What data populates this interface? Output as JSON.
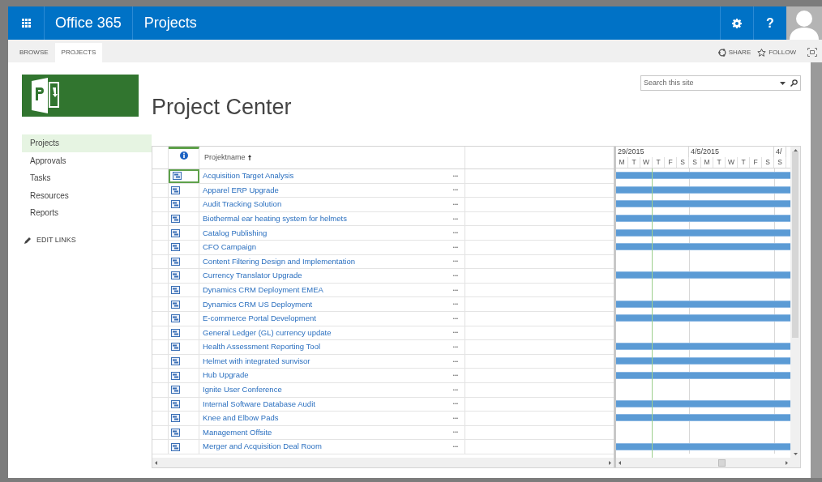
{
  "suite_bar": {
    "brand": "Office 365",
    "app": "Projects",
    "help": "?"
  },
  "ribbon": {
    "tabs": [
      {
        "label": "BROWSE",
        "selected": false
      },
      {
        "label": "PROJECTS",
        "selected": true
      }
    ],
    "actions": [
      {
        "label": "SHARE",
        "kind": "share"
      },
      {
        "label": "FOLLOW",
        "kind": "follow"
      }
    ]
  },
  "search": {
    "placeholder": "Search this site"
  },
  "page_title": "Project Center",
  "nav": {
    "items": [
      {
        "label": "Projects",
        "selected": true
      },
      {
        "label": "Approvals",
        "selected": false
      },
      {
        "label": "Tasks",
        "selected": false
      },
      {
        "label": "Resources",
        "selected": false
      },
      {
        "label": "Reports",
        "selected": false
      }
    ],
    "edit_links": "EDIT LINKS"
  },
  "grid": {
    "column": "Projektname",
    "rows": [
      {
        "name": "Acquisition Target Analysis",
        "focused": true,
        "bar": true
      },
      {
        "name": "Apparel ERP Upgrade",
        "focused": false,
        "bar": true
      },
      {
        "name": "Audit Tracking Solution",
        "focused": false,
        "bar": true
      },
      {
        "name": "Biothermal ear heating system for helmets",
        "focused": false,
        "bar": true
      },
      {
        "name": "Catalog Publishing",
        "focused": false,
        "bar": true
      },
      {
        "name": "CFO Campaign",
        "focused": false,
        "bar": true
      },
      {
        "name": "Content Filtering Design and Implementation",
        "focused": false,
        "bar": false
      },
      {
        "name": "Currency Translator Upgrade",
        "focused": false,
        "bar": true
      },
      {
        "name": "Dynamics CRM Deployment EMEA",
        "focused": false,
        "bar": false
      },
      {
        "name": "Dynamics CRM US Deployment",
        "focused": false,
        "bar": true
      },
      {
        "name": "E-commerce Portal Development",
        "focused": false,
        "bar": true
      },
      {
        "name": "General Ledger (GL) currency update",
        "focused": false,
        "bar": false
      },
      {
        "name": "Health Assessment Reporting Tool",
        "focused": false,
        "bar": true
      },
      {
        "name": "Helmet with integrated sunvisor",
        "focused": false,
        "bar": true
      },
      {
        "name": "Hub Upgrade",
        "focused": false,
        "bar": true
      },
      {
        "name": "Ignite User Conference",
        "focused": false,
        "bar": false
      },
      {
        "name": "Internal Software Database Audit",
        "focused": false,
        "bar": true
      },
      {
        "name": "Knee and Elbow Pads",
        "focused": false,
        "bar": true
      },
      {
        "name": "Management Offsite",
        "focused": false,
        "bar": false
      },
      {
        "name": "Merger and Acquisition Deal Room",
        "focused": false,
        "bar": true
      }
    ],
    "more": "•••"
  },
  "gantt": {
    "weeks": [
      {
        "label": "29/2015",
        "days": [
          "M",
          "T",
          "W",
          "T",
          "F",
          "S"
        ]
      },
      {
        "label": "4/5/2015",
        "days": [
          "S",
          "M",
          "T",
          "W",
          "T",
          "F",
          "S"
        ]
      },
      {
        "label": "4/",
        "days": [
          "S"
        ]
      }
    ]
  }
}
